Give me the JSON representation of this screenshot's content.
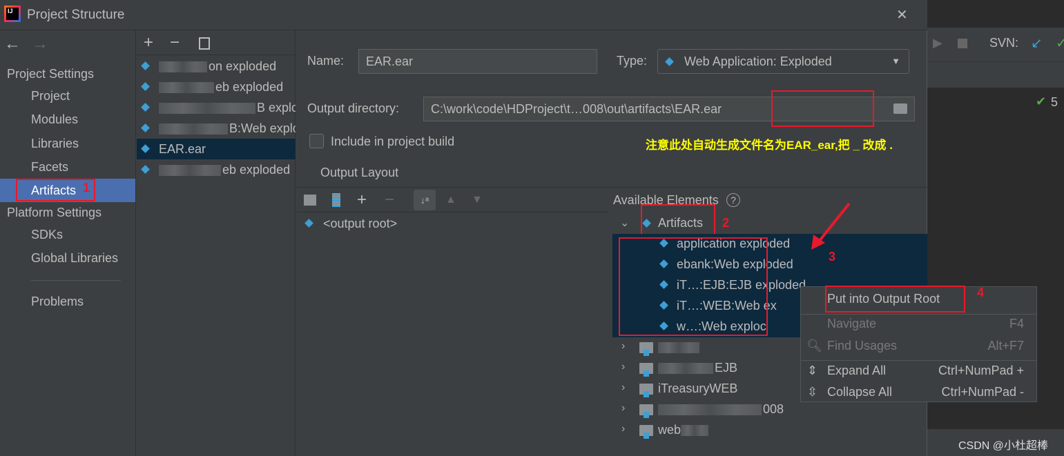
{
  "window": {
    "title": "Project Structure",
    "close": "✕"
  },
  "nav": {
    "back": "←",
    "forward": "→"
  },
  "sidebar": {
    "project_settings": "Project Settings",
    "items": [
      {
        "label": "Project"
      },
      {
        "label": "Modules"
      },
      {
        "label": "Libraries"
      },
      {
        "label": "Facets"
      },
      {
        "label": "Artifacts",
        "selected": true
      }
    ],
    "platform_settings": "Platform Settings",
    "platform_items": [
      {
        "label": "SDKs"
      },
      {
        "label": "Global Libraries"
      }
    ],
    "problems": "Problems"
  },
  "list_toolbar": {
    "add": "+",
    "remove": "−",
    "copy": "copy-icon"
  },
  "artifacts": [
    {
      "label": "on exploded",
      "icon": "ee-icon"
    },
    {
      "label": "eb exploded",
      "icon": "web-icon"
    },
    {
      "label": "B exploded",
      "icon": "ejb-icon"
    },
    {
      "label": "B:Web exploded",
      "icon": "web-icon"
    },
    {
      "label": "EAR.ear",
      "icon": "web-icon",
      "selected": true
    },
    {
      "label": "eb exploded",
      "icon": "web-icon"
    }
  ],
  "form": {
    "name_label": "Name:",
    "name_value": "EAR.ear",
    "type_label": "Type:",
    "type_value": "Web Application: Exploded",
    "output_label": "Output directory:",
    "output_value": "C:\\work\\code\\HDProject\\t…008\\out\\artifacts\\EAR.ear",
    "include_label": "Include in project build",
    "include_checked": false,
    "note": "注意此处自动生成文件名为EAR_ear,把 _ 改成 .",
    "note_color": "#ffff00"
  },
  "layout": {
    "title": "Output Layout",
    "root": "<output root>"
  },
  "available": {
    "title": "Available Elements",
    "help": "?",
    "group": "Artifacts",
    "items": [
      "application exploded",
      "ebank:Web exploded",
      "iT…:EJB:EJB exploded",
      "iT…:WEB:Web ex",
      "w…:Web exploc"
    ],
    "modules": [
      "",
      "EJB",
      "iTreasuryWEB",
      "008",
      "web"
    ]
  },
  "context_menu": {
    "items": [
      {
        "label": "Put into Output Root",
        "shortcut": ""
      },
      {
        "label": "Navigate",
        "shortcut": "F4",
        "disabled": true
      },
      {
        "label": "Find Usages",
        "shortcut": "Alt+F7",
        "disabled": true
      },
      {
        "label": "Expand All",
        "shortcut": "Ctrl+NumPad +"
      },
      {
        "label": "Collapse All",
        "shortcut": "Ctrl+NumPad -"
      }
    ]
  },
  "annotations": {
    "n1": "1",
    "n2": "2",
    "n3": "3",
    "n4": "4",
    "accent": "#e8192c"
  },
  "ide": {
    "svn": "SVN:",
    "count": "5",
    "watermark": "CSDN @小杜超棒"
  }
}
